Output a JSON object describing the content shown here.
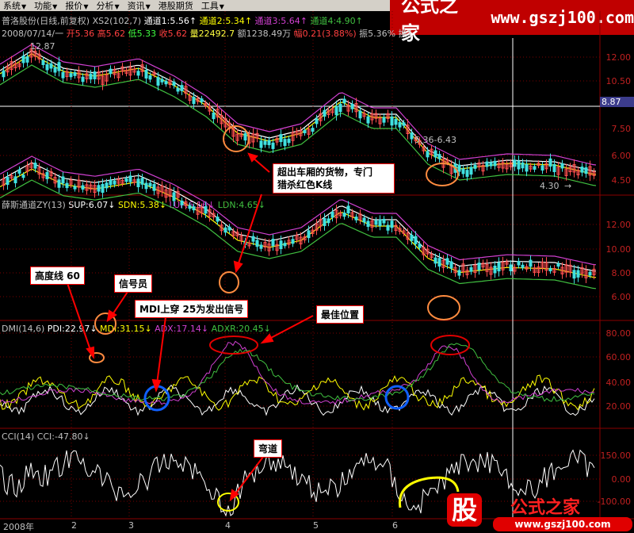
{
  "menu": [
    {
      "label": "系统"
    },
    {
      "label": "功能"
    },
    {
      "label": "报价"
    },
    {
      "label": "分析"
    },
    {
      "label": "资讯"
    },
    {
      "label": "港股期货"
    },
    {
      "label": "工具"
    }
  ],
  "brand": {
    "name": "公式之家",
    "url": "www.gszj100.com"
  },
  "main_panel": {
    "title": "普洛股份(日线,前复权)",
    "indicator": "XS2(102,7)",
    "lines": [
      {
        "label": "通道1:5.56",
        "color": "#ffffff"
      },
      {
        "label": "通道2:5.34",
        "color": "#ffff00"
      },
      {
        "label": "通道3:5.64",
        "color": "#d040d0"
      },
      {
        "label": "通道4:4.90",
        "color": "#40c040"
      }
    ],
    "info": {
      "date": "2008/07/14/一",
      "open": "开5.36",
      "high": "高5.62",
      "low": "低5.33",
      "close": "收5.62",
      "volume": "量22492.7",
      "amount": "额1238.49万",
      "change": "幅0.21(3.88%)",
      "amplitude": "振5.36%",
      "turnover": "换1"
    },
    "y_ticks": [
      "12.00",
      "10.50",
      "8.87",
      "7.50",
      "6.00",
      "4.50"
    ],
    "current_price": "8.87",
    "annotations": [
      "12.87",
      "5.36-6.43",
      "4.30"
    ]
  },
  "channel_panel": {
    "title": "薛斯通道ZY(13)",
    "lines": [
      {
        "label": "SUP:6.07",
        "color": "#ffffff"
      },
      {
        "label": "SDN:5.38",
        "color": "#ffff00"
      },
      {
        "label": "LUP:6.16",
        "color": "#d040d0"
      },
      {
        "label": "LDN:4.65",
        "color": "#40c040"
      }
    ],
    "y_ticks": [
      "12.00",
      "10.00",
      "8.00",
      "6.00"
    ]
  },
  "dmi_panel": {
    "title": "DMI(14,6)",
    "lines": [
      {
        "label": "PDI:22.97",
        "color": "#ffffff"
      },
      {
        "label": "MDI:31.15",
        "color": "#ffff00"
      },
      {
        "label": "ADX:17.14",
        "color": "#d040d0"
      },
      {
        "label": "ADXR:20.45",
        "color": "#40c040"
      }
    ],
    "y_ticks": [
      "80.00",
      "60.00",
      "40.00",
      "20.00"
    ]
  },
  "cci_panel": {
    "title": "CCI(14)",
    "value": "CCI:-47.80",
    "y_ticks": [
      "150.00",
      "0.00",
      "-100.00"
    ]
  },
  "x_labels": [
    "2008年",
    "2",
    "3",
    "4",
    "5",
    "6"
  ],
  "callouts": {
    "red_k": "超出车厢的货物，专门\n猎杀红色K线",
    "height_line": "高度线 60",
    "signal": "信号员",
    "mdi_cross": "MDI上穿 25为发出信号",
    "best": "最佳位置",
    "bend": "弯道"
  },
  "bottom_brand": {
    "char": "股",
    "name": "公式之家",
    "url": "www.gszj100.com"
  }
}
